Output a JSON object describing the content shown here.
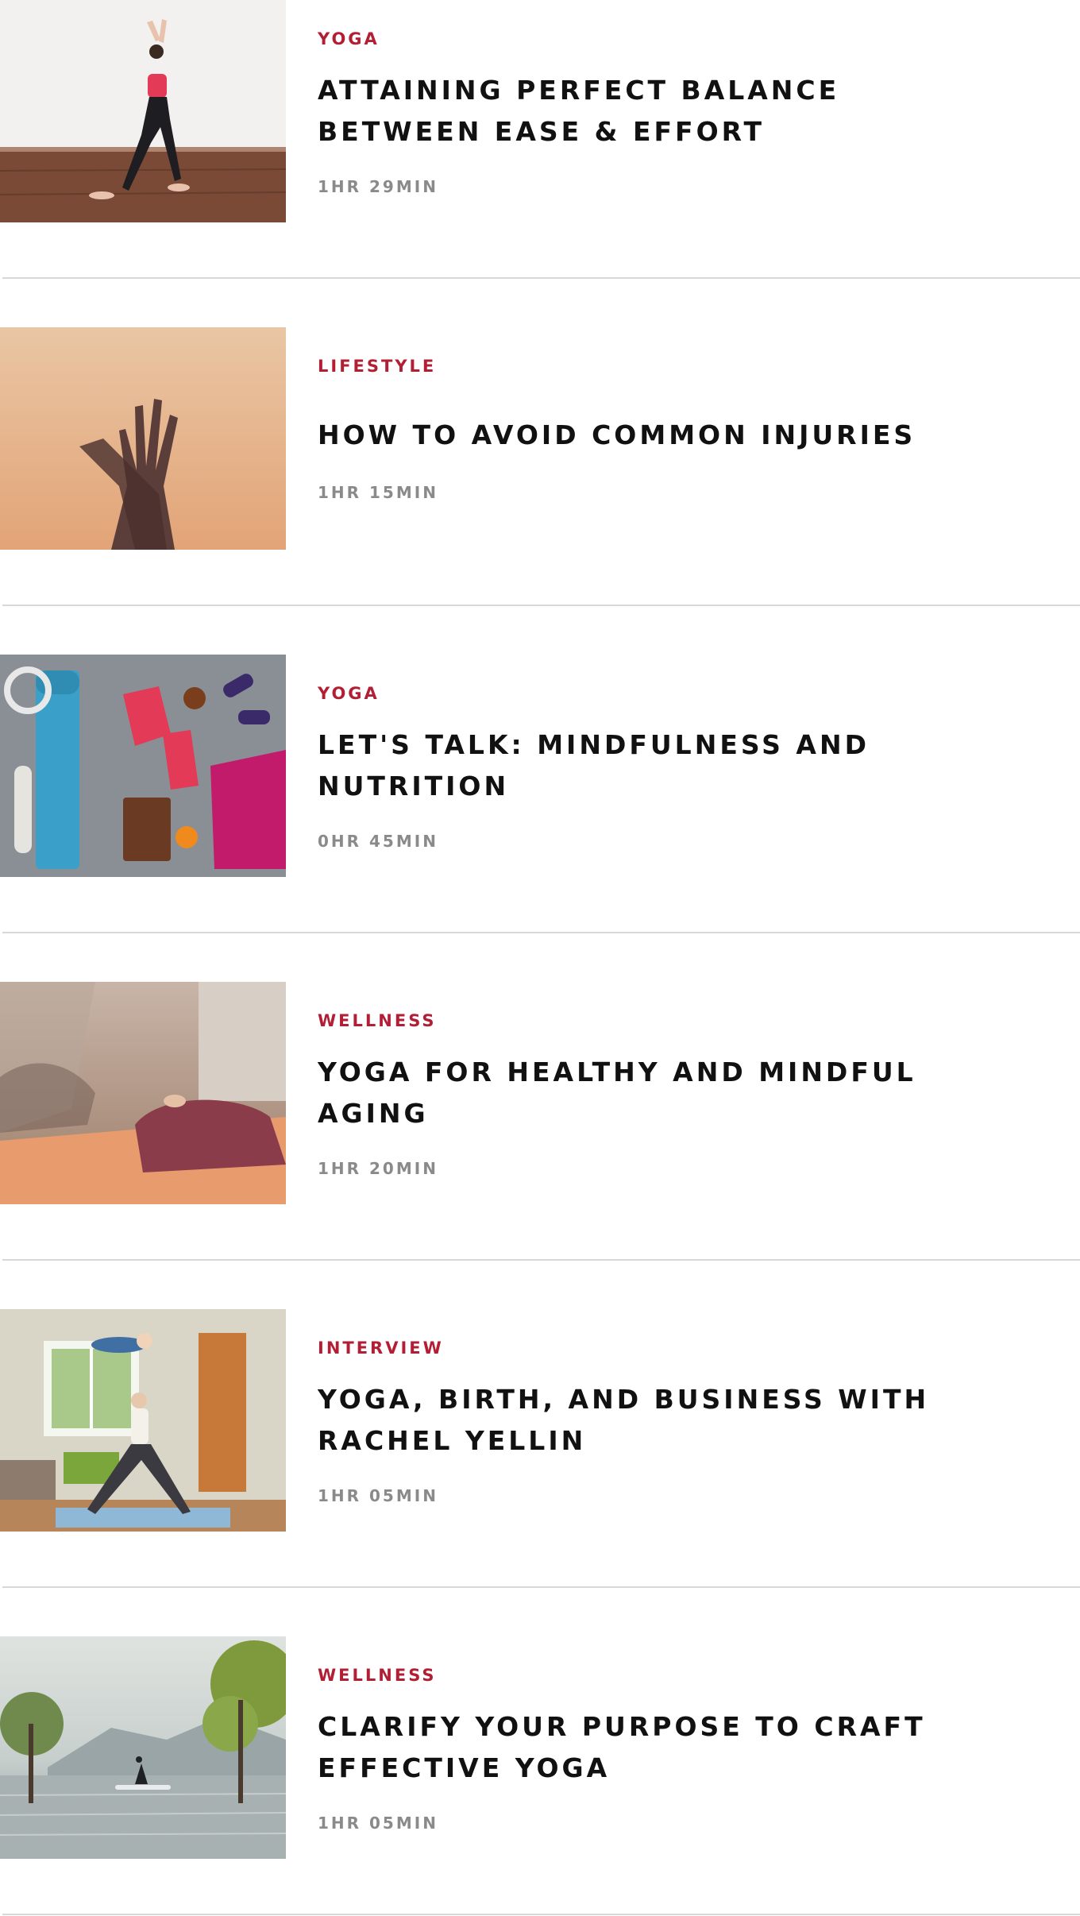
{
  "articles": [
    {
      "category": "YOGA",
      "title": "ATTAINING PERFECT BALANCE BETWEEN EASE & EFFORT",
      "duration": "1HR 29MIN",
      "image": "woman-yoga-pose-studio"
    },
    {
      "category": "LIFESTYLE",
      "title": "HOW TO AVOID COMMON INJURIES",
      "duration": "1HR 15MIN",
      "image": "hands-gesture"
    },
    {
      "category": "YOGA",
      "title": "LET'S TALK: MINDFULNESS AND NUTRITION",
      "duration": "0HR 45MIN",
      "image": "yoga-gear-flatlay"
    },
    {
      "category": "WELLNESS",
      "title": "YOGA FOR HEALTHY AND MINDFUL AGING",
      "duration": "1HR 20MIN",
      "image": "seated-meditation"
    },
    {
      "category": "INTERVIEW",
      "title": "YOGA, BIRTH, AND BUSINESS WITH RACHEL YELLIN",
      "duration": "1HR 05MIN",
      "image": "yoga-with-child-living-room"
    },
    {
      "category": "WELLNESS",
      "title": "CLARIFY YOUR PURPOSE TO CRAFT EFFECTIVE YOGA",
      "duration": "1HR 05MIN",
      "image": "yoga-on-paddleboard-lake"
    }
  ],
  "colors": {
    "accent": "#b21f35",
    "title": "#111111",
    "muted": "#8a8a8a",
    "divider": "#d8d8d8"
  }
}
